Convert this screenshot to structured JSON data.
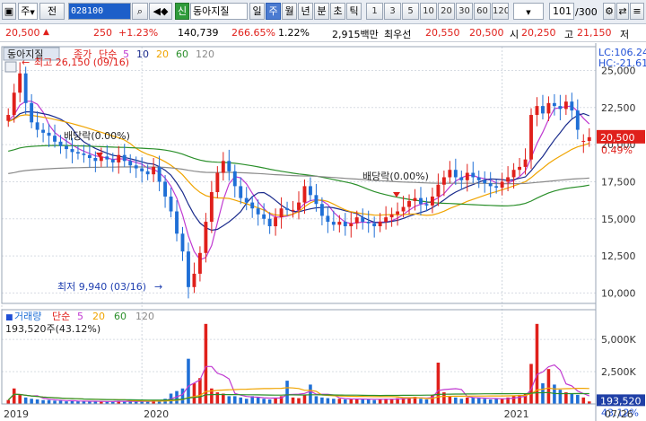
{
  "toolbar": {
    "type_select": "주",
    "prefix": "전",
    "code": "028100",
    "badge": "신",
    "name": "동아지질",
    "periods": [
      "일",
      "주",
      "월",
      "년",
      "분",
      "초",
      "틱"
    ],
    "selected_period": "주",
    "intervals": [
      "1",
      "3",
      "5",
      "10",
      "20",
      "30",
      "60",
      "120"
    ],
    "count": "101",
    "total": "/300"
  },
  "quote": {
    "price": "20,500",
    "change": "250",
    "rate": "+1.23%",
    "volume": "140,739",
    "vol_rate": "266.65%",
    "turnover": "1.22%",
    "amount": "2,915백만",
    "best_ask_label": "최우선",
    "best_ask": "20,550",
    "best_bid": "20,500",
    "open_label": "시",
    "open": "20,250",
    "high_label": "고",
    "high": "21,150",
    "low_label": "저"
  },
  "legend": {
    "name": "동아지질",
    "price_label": "종가",
    "ma_label": "단순",
    "ma": [
      "5",
      "10",
      "20",
      "60",
      "120"
    ],
    "vol_label": "거래량",
    "vol_value": "193,520주(43.12%)"
  },
  "colors": {
    "up": "#e0201b",
    "down": "#1f6fd6",
    "ma5": "#c03ad1",
    "ma10": "#1a2b8c",
    "ma20": "#f0a400",
    "ma60": "#2a8f2a",
    "ma120": "#8a8a8a"
  },
  "chart_data": {
    "type": "candlestick",
    "y_ticks": [
      "25,000",
      "22,500",
      "20,000",
      "17,500",
      "15,000",
      "12,500",
      "10,000"
    ],
    "y_values": [
      25000,
      22500,
      20000,
      17500,
      15000,
      12500,
      10000
    ],
    "ylim": [
      9300,
      26600
    ],
    "volume_ticks": [
      "5,000K",
      "2,500K"
    ],
    "volume_values": [
      5000,
      2500
    ],
    "volume_ylim": [
      0,
      7300
    ],
    "x_labels": [
      "2019",
      "2020",
      "2021",
      "07/26"
    ],
    "lc_label": "LC:106.24",
    "hc_label": "HC:-21.61",
    "current_price": "20,500",
    "current_rate": "0.49%",
    "current_volume": "193,520",
    "current_volume_rate": "43.12%",
    "annotations": [
      {
        "text": "최고 26,150 (09/16)",
        "kind": "high"
      },
      {
        "text": "최저 9,940 (03/16)",
        "kind": "low"
      },
      {
        "text": "배당락(0.00%)",
        "kind": "div"
      },
      {
        "text": "배당락(0.00%)",
        "kind": "div"
      }
    ],
    "close": [
      22000,
      23500,
      24800,
      22800,
      21500,
      21000,
      20800,
      20600,
      20200,
      19900,
      19700,
      19500,
      19400,
      19300,
      19100,
      18900,
      19200,
      19000,
      18800,
      19300,
      18900,
      18600,
      18400,
      18200,
      18000,
      18500,
      17500,
      16500,
      15500,
      14000,
      12800,
      10400,
      11300,
      12700,
      14800,
      16800,
      18100,
      18900,
      18200,
      17200,
      16400,
      16100,
      15700,
      15300,
      15000,
      14500,
      15100,
      15700,
      15600,
      15600,
      16100,
      17200,
      16600,
      16000,
      15200,
      14800,
      14600,
      14800,
      14500,
      14700,
      15100,
      14800,
      14700,
      14500,
      14800,
      15100,
      15300,
      15500,
      15800,
      16200,
      16400,
      16000,
      15900,
      16500,
      17300,
      17800,
      18300,
      17800,
      17600,
      18100,
      17800,
      17600,
      17400,
      17200,
      17100,
      17500,
      17800,
      18300,
      18500,
      19000,
      22000,
      22600,
      22100,
      22800,
      22600,
      22400,
      22900,
      22300,
      21000,
      20250,
      20500
    ],
    "open": [
      21600,
      22000,
      23500,
      24800,
      22800,
      21500,
      21000,
      20800,
      20600,
      20200,
      19900,
      19700,
      19500,
      19400,
      19300,
      19100,
      18900,
      19200,
      19000,
      18800,
      19300,
      18900,
      18600,
      18400,
      18200,
      18000,
      18500,
      17500,
      16500,
      15500,
      14000,
      12800,
      10400,
      11300,
      12700,
      14800,
      16800,
      18100,
      18900,
      18200,
      17200,
      16400,
      16100,
      15700,
      15300,
      15000,
      14500,
      15100,
      15700,
      15600,
      15600,
      16100,
      17200,
      16600,
      16000,
      15200,
      14800,
      14600,
      14800,
      14500,
      14700,
      15100,
      14800,
      14700,
      14500,
      14800,
      15100,
      15300,
      15500,
      15800,
      16200,
      16400,
      16000,
      15900,
      16500,
      17300,
      17800,
      18300,
      17800,
      17600,
      18100,
      17800,
      17600,
      17400,
      17200,
      17100,
      17500,
      17800,
      18300,
      18500,
      19000,
      22000,
      22600,
      22100,
      22800,
      22600,
      22400,
      22900,
      22300,
      20200,
      20250
    ],
    "volume": [
      300,
      1200,
      700,
      500,
      400,
      350,
      300,
      300,
      250,
      250,
      200,
      250,
      200,
      200,
      180,
      200,
      180,
      180,
      200,
      250,
      200,
      180,
      200,
      180,
      200,
      300,
      250,
      400,
      800,
      1000,
      1200,
      3500,
      1600,
      2000,
      6200,
      1200,
      900,
      800,
      600,
      600,
      500,
      400,
      600,
      500,
      400,
      350,
      450,
      600,
      1800,
      500,
      450,
      700,
      1500,
      600,
      500,
      450,
      400,
      400,
      350,
      350,
      400,
      400,
      350,
      300,
      350,
      400,
      400,
      450,
      450,
      500,
      550,
      400,
      350,
      700,
      3200,
      900,
      600,
      500,
      400,
      500,
      500,
      450,
      400,
      350,
      400,
      400,
      500,
      600,
      700,
      800,
      3100,
      6200,
      1600,
      2700,
      1500,
      1100,
      900,
      800,
      700,
      500,
      193
    ]
  }
}
